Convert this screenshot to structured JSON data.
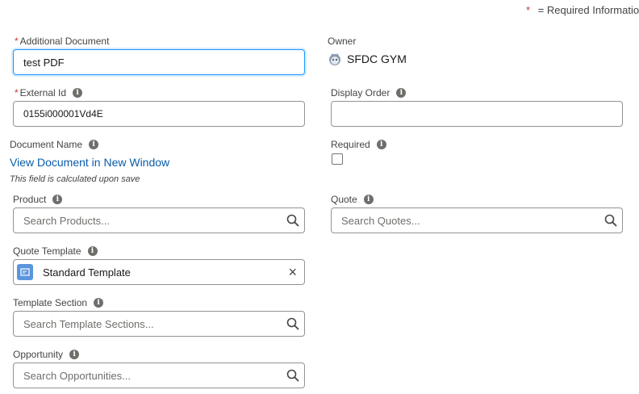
{
  "header": {
    "required_star": "*",
    "required_text": "= Required Information"
  },
  "left": {
    "additional_document": {
      "label": "Additional Document",
      "value": "test PDF"
    },
    "external_id": {
      "label": "External Id",
      "value": "0155i000001Vd4E"
    },
    "document_name": {
      "label": "Document Name",
      "link": "View Document in New Window",
      "note": "This field is calculated upon save"
    },
    "product": {
      "label": "Product",
      "placeholder": "Search Products..."
    },
    "quote_template": {
      "label": "Quote Template",
      "value": "Standard Template"
    },
    "template_section": {
      "label": "Template Section",
      "placeholder": "Search Template Sections..."
    },
    "opportunity": {
      "label": "Opportunity",
      "placeholder": "Search Opportunities..."
    }
  },
  "right": {
    "owner": {
      "label": "Owner",
      "value": "SFDC GYM"
    },
    "display_order": {
      "label": "Display Order",
      "value": ""
    },
    "required": {
      "label": "Required"
    },
    "quote": {
      "label": "Quote",
      "placeholder": "Search Quotes..."
    }
  },
  "icons": {
    "info": "i",
    "clear": "×"
  },
  "colors": {
    "accent": "#1b96ff",
    "link": "#0b5cab",
    "required": "#c23934",
    "template_icon": "#5a95dd"
  }
}
